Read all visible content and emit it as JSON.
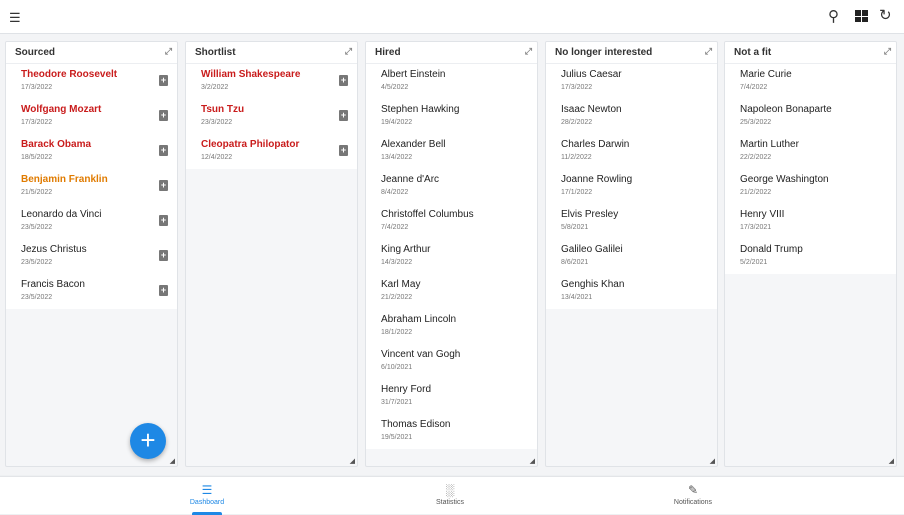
{
  "toolbar": {
    "menu_icon": "sort-lines-icon",
    "search_icon": "search-icon",
    "layout_icon": "grid-icon",
    "refresh_icon": "refresh-icon"
  },
  "columns": [
    {
      "title": "Sourced",
      "items": [
        {
          "name": "Theodore Roosevelt",
          "date": "17/3/2022",
          "style": "red",
          "doc": true
        },
        {
          "name": "Wolfgang Mozart",
          "date": "17/3/2022",
          "style": "red",
          "doc": true
        },
        {
          "name": "Barack Obama",
          "date": "18/5/2022",
          "style": "red",
          "doc": true
        },
        {
          "name": "Benjamin Franklin",
          "date": "21/5/2022",
          "style": "orange",
          "doc": true
        },
        {
          "name": "Leonardo da Vinci",
          "date": "23/5/2022",
          "style": "",
          "doc": true
        },
        {
          "name": "Jezus Christus",
          "date": "23/5/2022",
          "style": "",
          "doc": true
        },
        {
          "name": "Francis Bacon",
          "date": "23/5/2022",
          "style": "",
          "doc": true
        }
      ]
    },
    {
      "title": "Shortlist",
      "items": [
        {
          "name": "William Shakespeare",
          "date": "3/2/2022",
          "style": "red",
          "doc": true
        },
        {
          "name": "Tsun Tzu",
          "date": "23/3/2022",
          "style": "red",
          "doc": true
        },
        {
          "name": "Cleopatra Philopator",
          "date": "12/4/2022",
          "style": "red",
          "doc": true
        }
      ]
    },
    {
      "title": "Hired",
      "items": [
        {
          "name": "Albert Einstein",
          "date": "4/5/2022"
        },
        {
          "name": "Stephen Hawking",
          "date": "19/4/2022"
        },
        {
          "name": "Alexander Bell",
          "date": "13/4/2022"
        },
        {
          "name": "Jeanne d'Arc",
          "date": "8/4/2022"
        },
        {
          "name": "Christoffel Columbus",
          "date": "7/4/2022"
        },
        {
          "name": "King Arthur",
          "date": "14/3/2022"
        },
        {
          "name": "Karl May",
          "date": "21/2/2022"
        },
        {
          "name": "Abraham Lincoln",
          "date": "18/1/2022"
        },
        {
          "name": "Vincent van Gogh",
          "date": "6/10/2021"
        },
        {
          "name": "Henry Ford",
          "date": "31/7/2021"
        },
        {
          "name": "Thomas Edison",
          "date": "19/5/2021"
        }
      ]
    },
    {
      "title": "No longer interested",
      "items": [
        {
          "name": "Julius Caesar",
          "date": "17/3/2022"
        },
        {
          "name": "Isaac Newton",
          "date": "28/2/2022"
        },
        {
          "name": "Charles Darwin",
          "date": "11/2/2022"
        },
        {
          "name": "Joanne Rowling",
          "date": "17/1/2022"
        },
        {
          "name": "Elvis Presley",
          "date": "5/8/2021"
        },
        {
          "name": "Galileo Galilei",
          "date": "8/6/2021"
        },
        {
          "name": "Genghis Khan",
          "date": "13/4/2021"
        }
      ]
    },
    {
      "title": "Not a fit",
      "items": [
        {
          "name": "Marie Curie",
          "date": "7/4/2022"
        },
        {
          "name": "Napoleon Bonaparte",
          "date": "25/3/2022"
        },
        {
          "name": "Martin Luther",
          "date": "22/2/2022"
        },
        {
          "name": "George Washington",
          "date": "21/2/2022"
        },
        {
          "name": "Henry VIII",
          "date": "17/3/2021"
        },
        {
          "name": "Donald Trump",
          "date": "5/2/2021"
        }
      ]
    }
  ],
  "fab": {
    "label": "+"
  },
  "nav": {
    "tabs": [
      {
        "label": "Dashboard",
        "icon": "dashboard-list-icon",
        "active": true
      },
      {
        "label": "Statistics",
        "icon": "bar-chart-icon"
      },
      {
        "label": "Notifications",
        "icon": "edit-note-icon"
      }
    ]
  },
  "colors": {
    "accent": "#1e88e5",
    "red": "#c91c1c",
    "orange": "#e07b00"
  }
}
